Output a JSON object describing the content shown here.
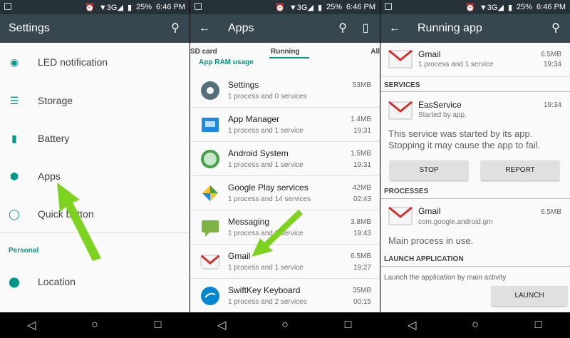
{
  "status": {
    "battery": "25%",
    "time": "6:46 PM",
    "network": "3G"
  },
  "panel1": {
    "title": "Settings",
    "items": [
      {
        "label": "LED notification",
        "icon": "led-icon"
      },
      {
        "label": "Storage",
        "icon": "storage-icon"
      },
      {
        "label": "Battery",
        "icon": "battery-icon"
      },
      {
        "label": "Apps",
        "icon": "android-icon"
      },
      {
        "label": "Quick button",
        "icon": "quick-button-icon"
      }
    ],
    "section": "Personal",
    "location": "Location"
  },
  "panel2": {
    "title": "Apps",
    "tabs": {
      "sd": "SD card",
      "running": "Running",
      "all": "All"
    },
    "ram_label": "App RAM usage",
    "apps": [
      {
        "name": "Settings",
        "sub": "1 process and 0 services",
        "size": "53MB",
        "time": "",
        "icon": "settings-gear-icon",
        "color": "#546e7a"
      },
      {
        "name": "App Manager",
        "sub": "1 process and 1 service",
        "size": "1.4MB",
        "time": "19:31",
        "icon": "app-manager-icon",
        "color": "#1e88e5"
      },
      {
        "name": "Android System",
        "sub": "1 process and 1 service",
        "size": "1.5MB",
        "time": "19:31",
        "icon": "android-system-icon",
        "color": "#43a047"
      },
      {
        "name": "Google Play services",
        "sub": "1 process and 14 services",
        "size": "42MB",
        "time": "02:43",
        "icon": "play-services-icon",
        "color": "#fbc02d"
      },
      {
        "name": "Messaging",
        "sub": "1 process and 1 service",
        "size": "3.8MB",
        "time": "19:43",
        "icon": "messaging-icon",
        "color": "#7cb342"
      },
      {
        "name": "Gmail",
        "sub": "1 process and 1 service",
        "size": "6.5MB",
        "time": "19:27",
        "icon": "gmail-icon",
        "color": "#d32f2f"
      },
      {
        "name": "SwiftKey Keyboard",
        "sub": "1 process and 2 services",
        "size": "35MB",
        "time": "00:15",
        "icon": "swiftkey-icon",
        "color": "#0288d1"
      }
    ]
  },
  "panel3": {
    "title": "Running app",
    "head": {
      "name": "Gmail",
      "sub": "1 process and 1 service",
      "size": "6.5MB",
      "time": "19:34"
    },
    "services_label": "SERVICES",
    "service": {
      "name": "EasService",
      "sub": "Started by app.",
      "time": "19:34"
    },
    "service_msg": "This service was started by its app. Stopping it may cause the app to fail.",
    "stop": "STOP",
    "report": "REPORT",
    "processes_label": "PROCESSES",
    "process": {
      "name": "Gmail",
      "sub": "com.google.android.gm",
      "size": "6.5MB"
    },
    "process_msg": "Main process in use.",
    "launch_label": "LAUNCH APPLICATION",
    "launch_desc": "Launch the application by main activity",
    "launch_btn": "LAUNCH"
  },
  "colors": {
    "accent": "#009688",
    "appbar": "#37474f",
    "arrow": "#7ed321"
  }
}
